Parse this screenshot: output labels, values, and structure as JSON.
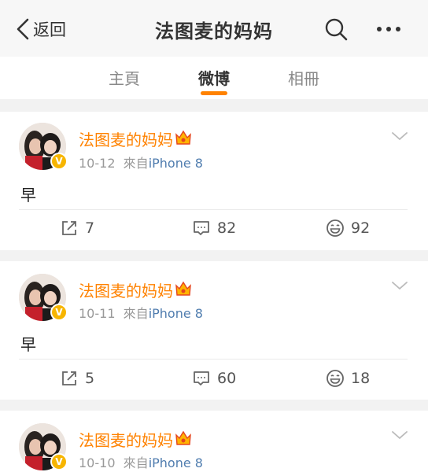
{
  "header": {
    "back_label": "返回",
    "title": "法图麦的妈妈"
  },
  "tabs": [
    {
      "label": "主頁"
    },
    {
      "label": "微博"
    },
    {
      "label": "相冊"
    }
  ],
  "accent_color": "#ff8200",
  "posts": [
    {
      "author": "法图麦的妈妈",
      "date": "10-12",
      "source_prefix": "來自",
      "source": "iPhone 8",
      "text": "早",
      "reposts": "7",
      "comments": "82",
      "likes": "92"
    },
    {
      "author": "法图麦的妈妈",
      "date": "10-11",
      "source_prefix": "來自",
      "source": "iPhone 8",
      "text": "早",
      "reposts": "5",
      "comments": "60",
      "likes": "18"
    },
    {
      "author": "法图麦的妈妈",
      "date": "10-10",
      "source_prefix": "來自",
      "source": "iPhone 8"
    }
  ]
}
